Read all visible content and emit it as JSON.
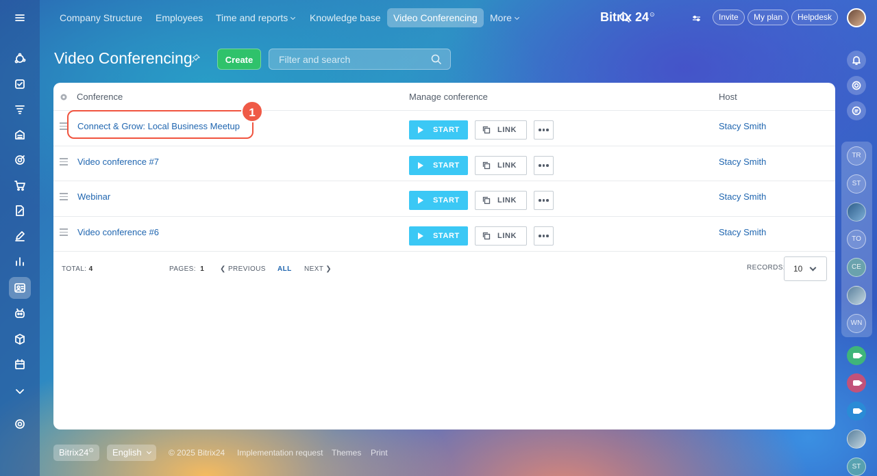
{
  "nav": {
    "items": [
      "Company Structure",
      "Employees",
      "Time and reports",
      "Knowledge base",
      "Video Conferencing",
      "More"
    ],
    "brand": "Bitrix 24",
    "invite": "Invite",
    "my_plan": "My plan",
    "helpdesk": "Helpdesk"
  },
  "page": {
    "title": "Video Conferencing",
    "create": "Create",
    "search_placeholder": "Filter and search"
  },
  "table": {
    "headers": {
      "conference": "Conference",
      "manage": "Manage conference",
      "host": "Host"
    },
    "rows": [
      {
        "name": "Connect & Grow: Local Business Meetup",
        "host": "Stacy Smith"
      },
      {
        "name": "Video conference #7",
        "host": "Stacy Smith"
      },
      {
        "name": "Webinar",
        "host": "Stacy Smith"
      },
      {
        "name": "Video conference #6",
        "host": "Stacy Smith"
      }
    ],
    "start_label": "START",
    "link_label": "LINK",
    "badge": "1"
  },
  "pager": {
    "total_label": "TOTAL:",
    "total": "4",
    "pages_label": "PAGES:",
    "pages": "1",
    "previous": "PREVIOUS",
    "all": "ALL",
    "next": "NEXT",
    "records_label": "RECORDS:",
    "records_value": "10"
  },
  "right_avatars": [
    "TR",
    "ST",
    "",
    "TO",
    "CE",
    "",
    "WN"
  ],
  "footer": {
    "brand": "Bitrix24",
    "language": "English",
    "copyright": "© 2025 Bitrix24",
    "implementation": "Implementation request",
    "themes": "Themes",
    "print": "Print"
  },
  "colors": {
    "accent_start": "#3bc8f5",
    "create": "#2fc26b",
    "link": "#2066b0",
    "highlight": "#f0533e"
  }
}
